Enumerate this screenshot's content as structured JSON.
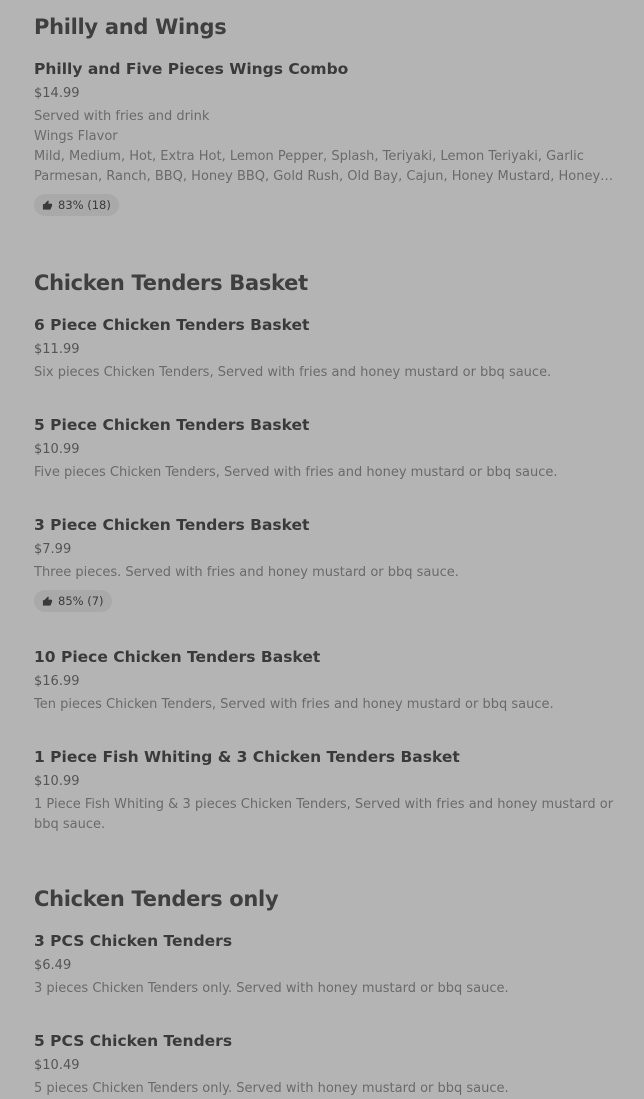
{
  "sections": [
    {
      "title": "Philly and Wings",
      "items": [
        {
          "name": "Philly and Five Pieces Wings Combo",
          "price": "$14.99",
          "desc_lines": [
            "Served with fries and drink",
            "Wings Flavor",
            "Mild, Medium, Hot, Extra Hot, Lemon Pepper, Splash, Teriyaki, Lemon Teriyaki, Garlic Parmesan, Ranch, BBQ, Honey BBQ, Gold Rush, Old Bay, Cajun, Honey Mustard, Honey Mild..."
          ],
          "rating": "83% (18)"
        }
      ]
    },
    {
      "title": "Chicken Tenders Basket",
      "items": [
        {
          "name": "6 Piece Chicken Tenders Basket",
          "price": "$11.99",
          "desc": "Six pieces Chicken Tenders, Served with fries and honey mustard or bbq sauce."
        },
        {
          "name": "5 Piece Chicken Tenders Basket",
          "price": "$10.99",
          "desc": "Five pieces Chicken Tenders, Served with fries and honey mustard or bbq sauce."
        },
        {
          "name": "3 Piece Chicken Tenders Basket",
          "price": "$7.99",
          "desc": "Three pieces. Served with fries and honey mustard or bbq sauce.",
          "rating": "85% (7)"
        },
        {
          "name": "10 Piece Chicken Tenders Basket",
          "price": "$16.99",
          "desc": "Ten pieces Chicken Tenders, Served with fries and honey mustard or bbq sauce."
        },
        {
          "name": "1 Piece Fish Whiting & 3 Chicken Tenders Basket",
          "price": "$10.99",
          "desc": "1 Piece Fish Whiting & 3 pieces Chicken Tenders, Served with fries and honey mustard or bbq sauce."
        }
      ]
    },
    {
      "title": "Chicken Tenders only",
      "items": [
        {
          "name": "3 PCS Chicken Tenders",
          "price": "$6.49",
          "desc": "3 pieces Chicken Tenders only. Served with honey mustard or bbq sauce."
        },
        {
          "name": "5 PCS Chicken Tenders",
          "price": "$10.49",
          "desc": "5 pieces Chicken Tenders only. Served with honey mustard or bbq sauce."
        }
      ]
    }
  ],
  "icons": {
    "rating": "thumbs-up-icon"
  },
  "colors": {
    "background": "#b4b4b4",
    "text": "#3a3a3a",
    "muted": "#6a6a6a",
    "badge": "#a9a9a9"
  }
}
